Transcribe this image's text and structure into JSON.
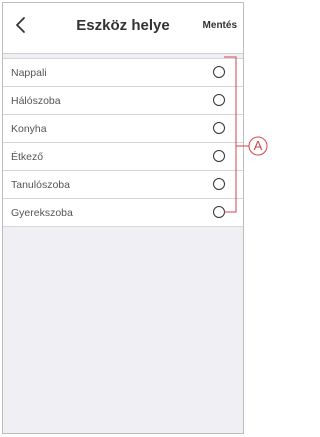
{
  "header": {
    "back_icon": "chevron-left-icon",
    "title": "Eszköz helye",
    "save_label": "Mentés"
  },
  "rooms": [
    {
      "label": "Nappali",
      "selected": false
    },
    {
      "label": "Hálószoba",
      "selected": false
    },
    {
      "label": "Konyha",
      "selected": false
    },
    {
      "label": "Étkező",
      "selected": false
    },
    {
      "label": "Tanulószoba",
      "selected": false
    },
    {
      "label": "Gyerekszoba",
      "selected": false
    }
  ],
  "annotation": {
    "letter": "A",
    "color": "#d0454c"
  }
}
